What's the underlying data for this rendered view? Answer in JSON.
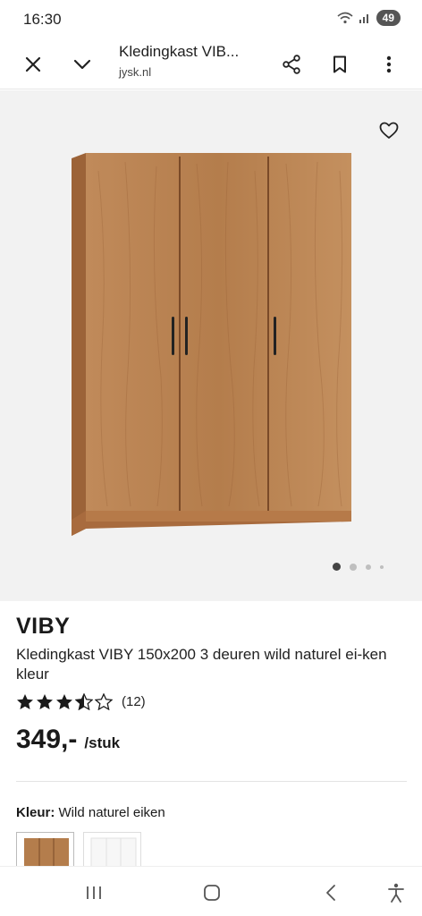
{
  "status": {
    "time": "16:30",
    "battery": "49"
  },
  "browser": {
    "title": "Kledingkast VIB...",
    "domain": "jysk.nl"
  },
  "gallery": {
    "image_alt": "wardrobe",
    "slide_count": 4,
    "active_slide": 1
  },
  "product": {
    "brand": "VIBY",
    "name": "Kledingkast VIBY 150x200 3 deuren wild naturel ei-ken kleur",
    "rating": 3.5,
    "rating_count": "(12)",
    "price": "349,-",
    "price_unit": "/stuk"
  },
  "color": {
    "label": "Kleur:",
    "value": "Wild naturel eiken"
  },
  "colors": {
    "wood": "#b9804f",
    "wood_dark": "#8a5530",
    "accent": "#1a1a1a"
  }
}
